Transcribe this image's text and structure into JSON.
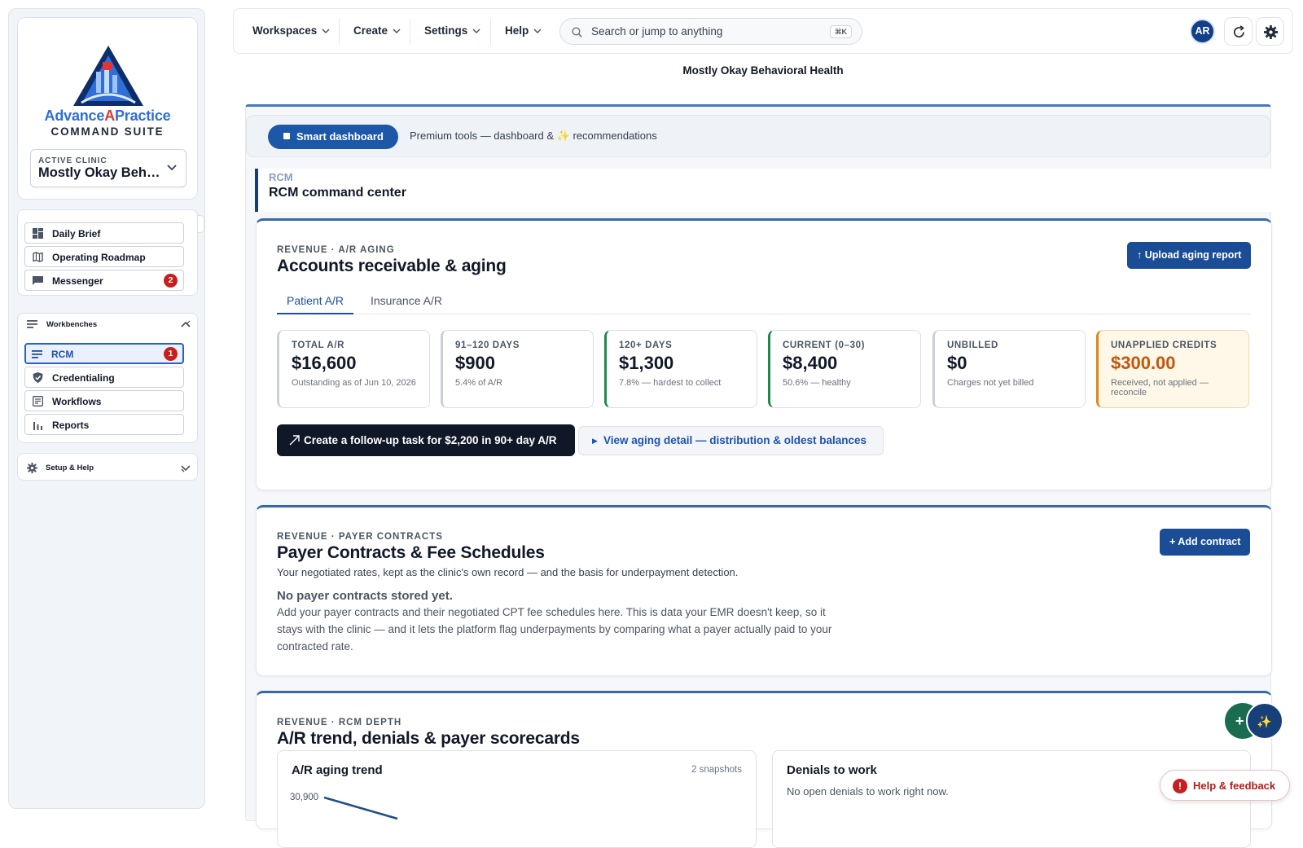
{
  "brand": {
    "name_part1": "Advance",
    "name_part2": "A",
    "name_part3": "Practice",
    "suite": "COMMAND SUITE"
  },
  "clinic": {
    "label": "ACTIVE CLINIC",
    "value": "Mostly Okay Beh…"
  },
  "nav_primary": [
    {
      "label": "Daily Brief",
      "icon": "dashboard-icon"
    },
    {
      "label": "Operating Roadmap",
      "icon": "map-icon"
    },
    {
      "label": "Messenger",
      "icon": "chat-icon",
      "badge": "2"
    }
  ],
  "workbenches": {
    "label": "Workbenches",
    "items": [
      {
        "label": "RCM",
        "icon": "list-icon",
        "badge": "1",
        "active": true
      },
      {
        "label": "Credentialing",
        "icon": "shield-check-icon"
      },
      {
        "label": "Workflows",
        "icon": "workflow-icon"
      },
      {
        "label": "Reports",
        "icon": "bar-chart-icon"
      }
    ]
  },
  "setup": {
    "label": "Setup & Help"
  },
  "topbar": {
    "menus": [
      "Workspaces",
      "Create",
      "Settings",
      "Help"
    ],
    "search_placeholder": "Search or jump to anything",
    "search_shortcut": "⌘K",
    "avatar": "AR"
  },
  "page_title": "Mostly Okay Behavioral Health",
  "smart_bar": {
    "button": "Smart dashboard",
    "text_before": "Premium tools — dashboard & ",
    "spark": "✨",
    "text_after": " recommendations"
  },
  "rcm": {
    "kicker": "RCM",
    "title": "RCM command center"
  },
  "ar_card": {
    "kicker": "REVENUE · A/R AGING",
    "title": "Accounts receivable & aging",
    "upload_button": "↑ Upload aging report",
    "tabs": [
      "Patient A/R",
      "Insurance A/R"
    ],
    "active_tab": "Patient A/R",
    "kpis": [
      {
        "label": "TOTAL A/R",
        "value": "$16,600",
        "note": "Outstanding as of Jun 10, 2026",
        "tone": "neutral"
      },
      {
        "label": "91–120 DAYS",
        "value": "$900",
        "note": "5.4% of A/R",
        "tone": "neutral"
      },
      {
        "label": "120+ DAYS",
        "value": "$1,300",
        "note": "7.8% — hardest to collect",
        "tone": "green"
      },
      {
        "label": "CURRENT (0–30)",
        "value": "$8,400",
        "note": "50.6% — healthy",
        "tone": "green"
      },
      {
        "label": "UNBILLED",
        "value": "$0",
        "note": "Charges not yet billed",
        "tone": "neutral"
      },
      {
        "label": "UNAPPLIED CREDITS",
        "value": "$300.00",
        "note": "Received, not applied — reconcile",
        "tone": "warn"
      }
    ],
    "task_button": "Create a follow-up task for $2,200 in 90+ day A/R",
    "detail_link": "View aging detail — distribution & oldest balances"
  },
  "contracts_card": {
    "kicker": "REVENUE · PAYER CONTRACTS",
    "title": "Payer Contracts & Fee Schedules",
    "add_button": "+ Add contract",
    "subtitle": "Your negotiated rates, kept as the clinic's own record — and the basis for underpayment detection.",
    "empty_title": "No payer contracts stored yet.",
    "empty_body": "Add your payer contracts and their negotiated CPT fee schedules here. This is data your EMR doesn't keep, so it stays with the clinic — and it lets the platform flag underpayments by comparing what a payer actually paid to your contracted rate."
  },
  "depth_card": {
    "kicker": "REVENUE · RCM DEPTH",
    "title": "A/R trend, denials & payer scorecards",
    "trend_panel": {
      "title": "A/R aging trend",
      "meta": "2 snapshots",
      "first_tick": "30,900"
    },
    "denials_panel": {
      "title": "Denials to work",
      "body": "No open denials to work right now."
    }
  },
  "help_button": "Help & feedback",
  "colors": {
    "primary": "#1a4d96",
    "accent_blue": "#2e6ed6",
    "accent_red": "#e13434",
    "badge_red": "#c81e1e",
    "healthy_green": "#1f8a4a",
    "warn_orange": "#c2560d"
  }
}
